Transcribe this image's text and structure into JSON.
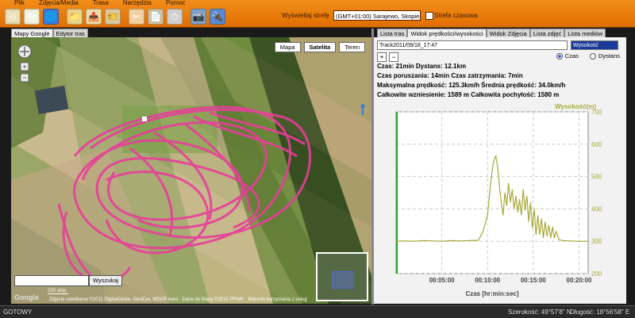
{
  "menu": [
    "Plik",
    "Zdjęcia/Media",
    "Trasa",
    "Narzędzia",
    "Pomoc"
  ],
  "toolbar": {
    "timezone_label": "Wyświetlaj strefę",
    "timezone_value": "(GMT+01:00) Sarajewo, Skopie, Warsz",
    "timezone_checkbox_label": "Strefa czasowa"
  },
  "left_tabs": [
    "Mapy Google",
    "Edytor tras"
  ],
  "map": {
    "type_buttons": [
      "Mapa",
      "Satelita",
      "Teren"
    ],
    "active_type": "Satelita",
    "search_button": "Wyszukaj",
    "scale": "100 stóp",
    "logo": "Google",
    "copyright": "Zdjęcie satelitarne ©2011 DigitalGlobe, GeoEye, MDGP Aero · Dane do Mapy ©2011 PPWK · Warunki korzystania z usług"
  },
  "right_tabs": [
    "Lista tras",
    "Widok prędkości/wysokości",
    "Widok Zdjęcia",
    "Lista zdjęć",
    "Lista mediów"
  ],
  "profile": {
    "track": "Track2011/09/18_17:47",
    "metric": "Wysokość",
    "zoom_in": "+",
    "zoom_out": "−",
    "radio_time": "Czas",
    "radio_distance": "Dystans",
    "stat1": "Czas: 21min  Dystans: 12.1km",
    "stat2": "Czas poruszania: 14min  Czas zatrzymania: 7min",
    "stat3": "Maksymalna prędkość: 125.3km/h  Średnia prędkość: 34.0km/h",
    "stat4": "Całkowite wzniesienie: 1589 m  Całkowita pochyłość: 1580 m"
  },
  "chart_data": {
    "type": "line",
    "ylabel": "Wysokość(m)",
    "xlabel": "Czas [hr:min:sec]",
    "ylim": [
      200,
      700
    ],
    "yticks": [
      200,
      300,
      400,
      500,
      600,
      700
    ],
    "xticks": [
      "00:05:00",
      "00:10:00",
      "00:15:00",
      "00:20:00"
    ],
    "xlim_min": [
      0,
      21
    ],
    "series": [
      {
        "values": [
          [
            0,
            300
          ],
          [
            1,
            301
          ],
          [
            2,
            300
          ],
          [
            3,
            302
          ],
          [
            4,
            301
          ],
          [
            5,
            300
          ],
          [
            6,
            302
          ],
          [
            7,
            301
          ],
          [
            8,
            302
          ],
          [
            9,
            303
          ],
          [
            9.5,
            330
          ],
          [
            10,
            380
          ],
          [
            10.3,
            470
          ],
          [
            10.6,
            540
          ],
          [
            10.9,
            565
          ],
          [
            11.1,
            530
          ],
          [
            11.3,
            470
          ],
          [
            11.5,
            420
          ],
          [
            11.7,
            380
          ],
          [
            11.9,
            450
          ],
          [
            12.1,
            410
          ],
          [
            12.3,
            480
          ],
          [
            12.5,
            420
          ],
          [
            12.7,
            460
          ],
          [
            12.9,
            400
          ],
          [
            13.1,
            440
          ],
          [
            13.3,
            390
          ],
          [
            13.5,
            430
          ],
          [
            13.7,
            380
          ],
          [
            13.9,
            460
          ],
          [
            14.1,
            395
          ],
          [
            14.3,
            440
          ],
          [
            14.5,
            360
          ],
          [
            14.7,
            420
          ],
          [
            14.9,
            340
          ],
          [
            15.1,
            400
          ],
          [
            15.3,
            320
          ],
          [
            15.5,
            380
          ],
          [
            15.7,
            320
          ],
          [
            15.9,
            370
          ],
          [
            16.1,
            310
          ],
          [
            16.3,
            360
          ],
          [
            16.5,
            315
          ],
          [
            16.7,
            350
          ],
          [
            16.9,
            310
          ],
          [
            17.1,
            345
          ],
          [
            17.3,
            310
          ],
          [
            17.5,
            330
          ],
          [
            17.8,
            305
          ],
          [
            18.2,
            302
          ],
          [
            19,
            301
          ],
          [
            20,
            300
          ],
          [
            21,
            300
          ]
        ]
      }
    ]
  },
  "status": {
    "left": "GOTOWY",
    "lat": "Szerokość: 49°57'8\" N",
    "lon": "Długość: 18°56'58\" E"
  },
  "colors": {
    "accent": "#f28d1a",
    "track": "#e83e9a",
    "altitude_line": "#a8a838",
    "start_line": "#2aa02a"
  }
}
